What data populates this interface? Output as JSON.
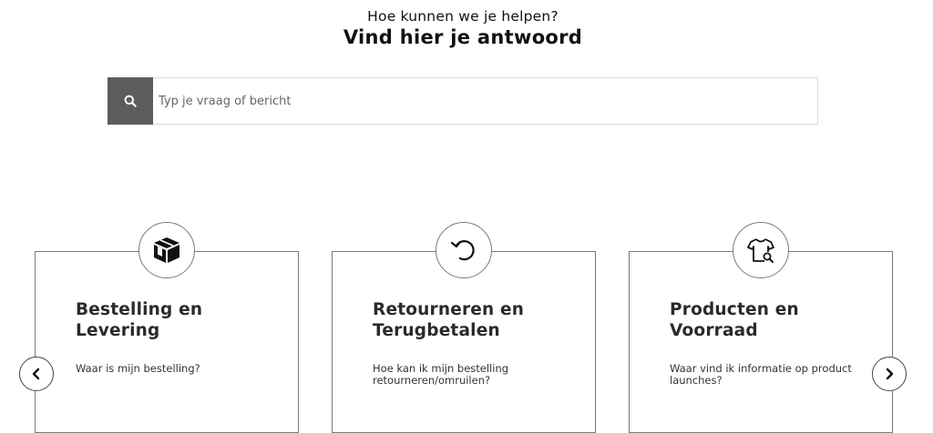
{
  "hero": {
    "subtitle": "Hoe kunnen we je helpen?",
    "title": "Vind hier je antwoord"
  },
  "search": {
    "placeholder": "Typ je vraag of bericht",
    "icon": "search-icon"
  },
  "cards": [
    {
      "icon": "package-icon",
      "title": "Bestelling en Levering",
      "question": "Waar is mijn bestelling?"
    },
    {
      "icon": "return-arrow-icon",
      "title": "Retourneren en Terugbetalen",
      "question": "Hoe kan ik mijn bestelling retourneren/omruilen?"
    },
    {
      "icon": "shirt-search-icon",
      "title": "Producten en Voorraad",
      "question": "Waar vind ik informatie op product launches?"
    }
  ],
  "carousel": {
    "prev_icon": "chevron-left-icon",
    "next_icon": "chevron-right-icon"
  },
  "colors": {
    "search_button": "#5c5c5c",
    "border": "#7a7a7a",
    "text": "#1a1a1a"
  }
}
